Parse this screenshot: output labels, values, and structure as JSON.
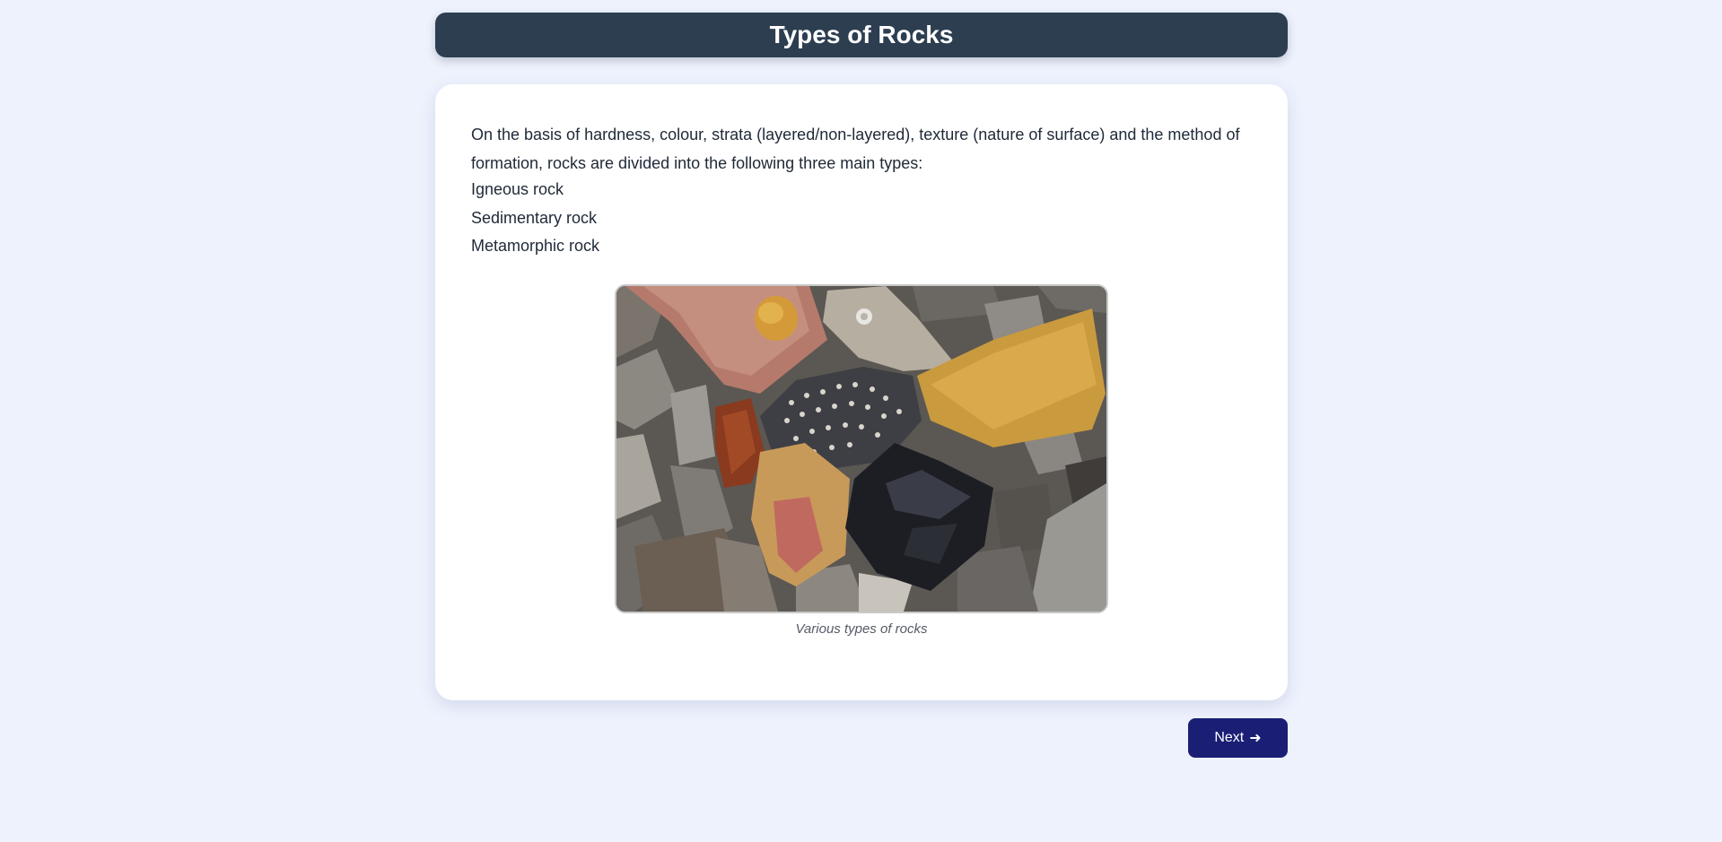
{
  "header": {
    "title": "Types of Rocks"
  },
  "content": {
    "intro": "On the basis of hardness, colour, strata (layered/non-layered), texture (nature of surface) and the method of formation, rocks are divided into the following three main types:",
    "rock_types": [
      "Igneous rock",
      "Sedimentary rock",
      "Metamorphic rock"
    ],
    "image_caption": "Various types of rocks"
  },
  "navigation": {
    "next_label": "Next",
    "next_icon": "arrow-right-icon",
    "next_arrow": "➜"
  },
  "colors": {
    "page_background": "#eef2fd",
    "header_background": "#2c3e50",
    "card_background": "#ffffff",
    "button_background": "#1a1f75"
  }
}
